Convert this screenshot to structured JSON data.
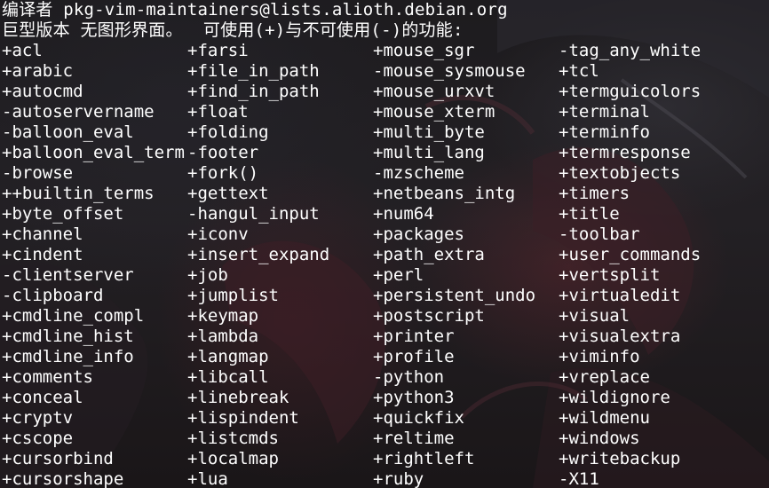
{
  "terminal": {
    "maintainer_line": "编译者 pkg-vim-maintainers@lists.alioth.debian.org",
    "features_header": "巨型版本 无图形界面。  可使用(+)与不可使用(-)的功能:",
    "features": [
      [
        "+acl",
        "+farsi",
        "+mouse_sgr",
        "-tag_any_white"
      ],
      [
        "+arabic",
        "+file_in_path",
        "-mouse_sysmouse",
        "+tcl"
      ],
      [
        "+autocmd",
        "+find_in_path",
        "+mouse_urxvt",
        "+termguicolors"
      ],
      [
        "-autoservername",
        "+float",
        "+mouse_xterm",
        "+terminal"
      ],
      [
        "-balloon_eval",
        "+folding",
        "+multi_byte",
        "+terminfo"
      ],
      [
        "+balloon_eval_term",
        "-footer",
        "+multi_lang",
        "+termresponse"
      ],
      [
        "-browse",
        "+fork()",
        "-mzscheme",
        "+textobjects"
      ],
      [
        "++builtin_terms",
        "+gettext",
        "+netbeans_intg",
        "+timers"
      ],
      [
        "+byte_offset",
        "-hangul_input",
        "+num64",
        "+title"
      ],
      [
        "+channel",
        "+iconv",
        "+packages",
        "-toolbar"
      ],
      [
        "+cindent",
        "+insert_expand",
        "+path_extra",
        "+user_commands"
      ],
      [
        "-clientserver",
        "+job",
        "+perl",
        "+vertsplit"
      ],
      [
        "-clipboard",
        "+jumplist",
        "+persistent_undo",
        "+virtualedit"
      ],
      [
        "+cmdline_compl",
        "+keymap",
        "+postscript",
        "+visual"
      ],
      [
        "+cmdline_hist",
        "+lambda",
        "+printer",
        "+visualextra"
      ],
      [
        "+cmdline_info",
        "+langmap",
        "+profile",
        "+viminfo"
      ],
      [
        "+comments",
        "+libcall",
        "-python",
        "+vreplace"
      ],
      [
        "+conceal",
        "+linebreak",
        "+python3",
        "+wildignore"
      ],
      [
        "+cryptv",
        "+lispindent",
        "+quickfix",
        "+wildmenu"
      ],
      [
        "+cscope",
        "+listcmds",
        "+reltime",
        "+windows"
      ],
      [
        "+cursorbind",
        "+localmap",
        "+rightleft",
        "+writebackup"
      ],
      [
        "+cursorshape",
        "+lua",
        "+ruby",
        "-X11"
      ]
    ]
  },
  "colors": {
    "text": "#ffffff",
    "background": "#1a1718"
  }
}
